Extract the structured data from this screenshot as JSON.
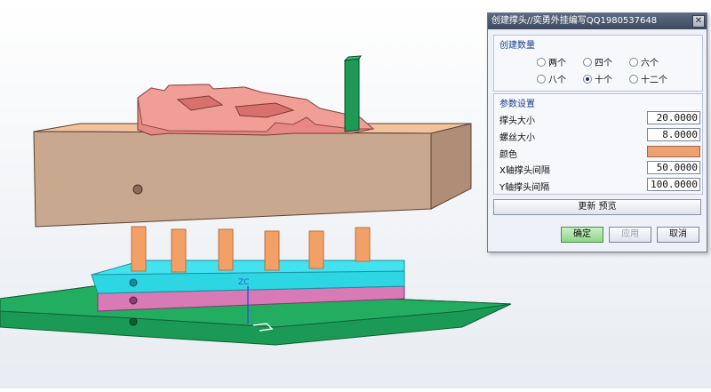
{
  "dialog": {
    "title": "创建撑头//奕勇外挂编写QQ1980537648",
    "close_glyph": "✕",
    "count_group": {
      "title": "创建数量",
      "options": [
        {
          "label": "两个",
          "selected": false
        },
        {
          "label": "四个",
          "selected": false
        },
        {
          "label": "六个",
          "selected": false
        },
        {
          "label": "八个",
          "selected": false
        },
        {
          "label": "十个",
          "selected": true
        },
        {
          "label": "十二个",
          "selected": false
        }
      ]
    },
    "params_group": {
      "title": "参数设置",
      "head_size_label": "撑头大小",
      "head_size_value": "20.0000",
      "screw_size_label": "螺丝大小",
      "screw_size_value": "8.0000",
      "color_label": "颜色",
      "color_value": "#f0a070",
      "x_spacing_label": "X轴撑头间隔",
      "x_spacing_value": "50.0000",
      "y_spacing_label": "Y轴撑头间隔",
      "y_spacing_value": "100.0000"
    },
    "update_preview_label": "更新  预览",
    "ok_label": "确定",
    "apply_label": "应用",
    "cancel_label": "取消"
  },
  "viewport": {
    "axis_label": "ZC"
  }
}
